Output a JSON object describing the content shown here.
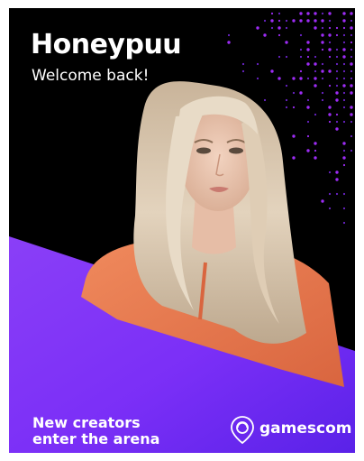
{
  "creator": {
    "name": "Honeypuu",
    "greeting": "Welcome back!"
  },
  "campaign": {
    "tagline_line1": "New creators",
    "tagline_line2": "enter the arena"
  },
  "brand": {
    "name": "gamescom",
    "icon": "gamescom-pin-logo-icon"
  },
  "colors": {
    "background": "#000000",
    "accent_purple": "#7b2ff7",
    "accent_violet": "#9d2cf5",
    "hoodie": "#e8784f",
    "text": "#ffffff"
  }
}
